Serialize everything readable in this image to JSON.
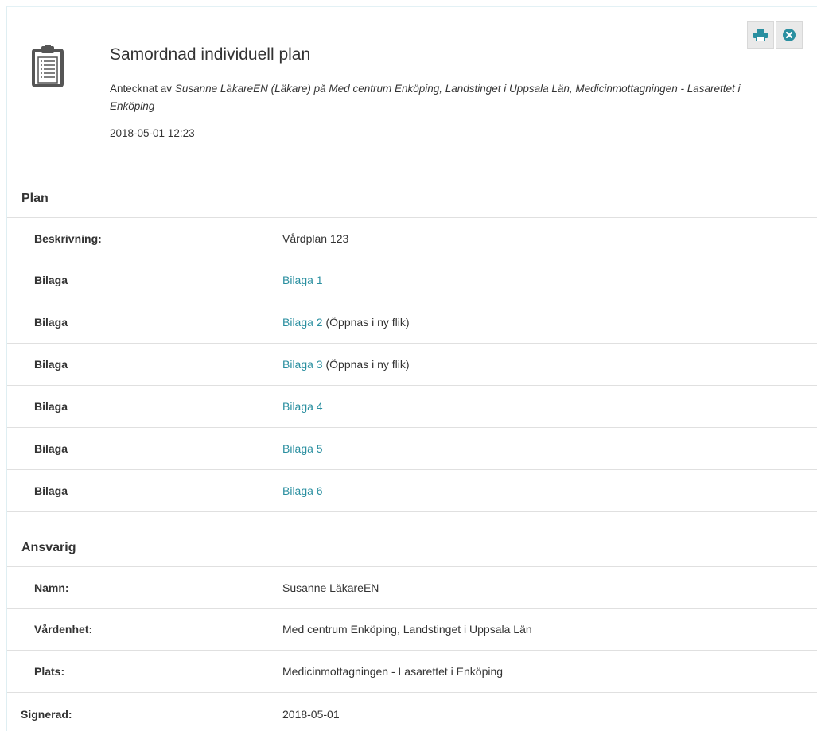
{
  "header": {
    "title": "Samordnad individuell plan",
    "meta_prefix": "Antecknat av",
    "meta_author": "Susanne LäkareEN (Läkare) på Med centrum Enköping, Landstinget i Uppsala Län, Medicinmottagningen - Lasarettet i Enköping",
    "timestamp": "2018-05-01 12:23",
    "icon": "clipboard-icon"
  },
  "toolbar": {
    "print_icon": "print-icon",
    "close_icon": "close-circle-icon",
    "accent_color": "#2a8fa0"
  },
  "plan": {
    "title": "Plan",
    "rows": [
      {
        "label": "Beskrivning:",
        "value": "Vårdplan 123",
        "link": "",
        "suffix": ""
      },
      {
        "label": "Bilaga",
        "value": "",
        "link": "Bilaga 1",
        "suffix": ""
      },
      {
        "label": "Bilaga",
        "value": "",
        "link": "Bilaga 2",
        "suffix": " (Öppnas i ny flik)"
      },
      {
        "label": "Bilaga",
        "value": "",
        "link": "Bilaga 3",
        "suffix": " (Öppnas i ny flik)"
      },
      {
        "label": "Bilaga",
        "value": "",
        "link": "Bilaga 4",
        "suffix": ""
      },
      {
        "label": "Bilaga",
        "value": "",
        "link": "Bilaga 5",
        "suffix": ""
      },
      {
        "label": "Bilaga",
        "value": "",
        "link": "Bilaga 6",
        "suffix": ""
      }
    ]
  },
  "ansvarig": {
    "title": "Ansvarig",
    "rows": [
      {
        "label": "Namn:",
        "value": "Susanne LäkareEN"
      },
      {
        "label": "Vårdenhet:",
        "value": "Med centrum Enköping, Landstinget i Uppsala Län"
      },
      {
        "label": "Plats:",
        "value": "Medicinmottagningen - Lasarettet i Enköping"
      }
    ]
  },
  "signerad": {
    "label": "Signerad:",
    "value": "2018-05-01"
  }
}
